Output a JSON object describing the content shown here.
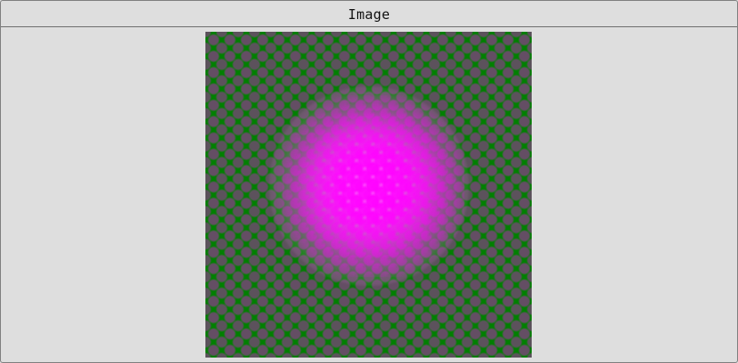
{
  "window": {
    "title": "Image"
  },
  "viewer": {
    "image_name": "pattern-image",
    "colors": {
      "background": "#008000",
      "accent": "#ff00ff",
      "dots": "#804080"
    }
  }
}
